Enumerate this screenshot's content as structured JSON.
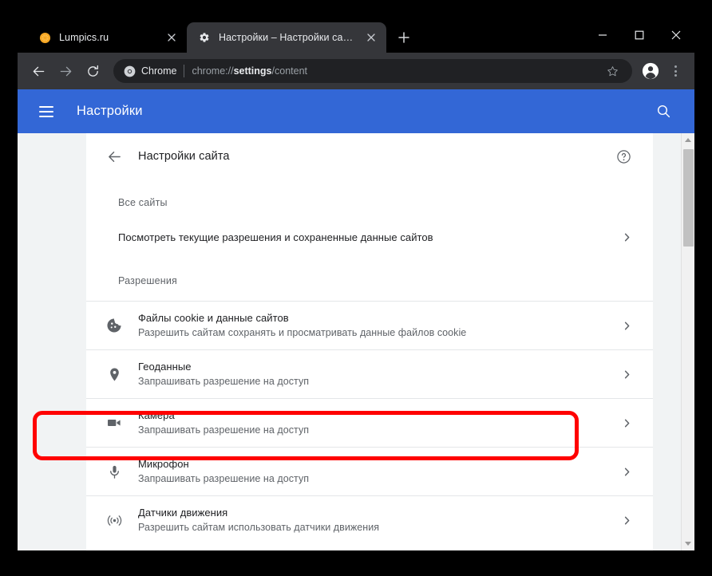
{
  "browser": {
    "tabs": [
      {
        "title": "Lumpics.ru",
        "favicon": "orange-citrus-icon",
        "active": false,
        "close_label": "×"
      },
      {
        "title": "Настройки – Настройки сайта",
        "favicon": "gear-icon",
        "active": true,
        "close_label": "×"
      }
    ],
    "new_tab_label": "+",
    "window_controls": {
      "minimize": "—",
      "maximize": "☐",
      "close": "×"
    },
    "toolbar": {
      "back_icon": "arrow-left-icon",
      "forward_icon": "arrow-right-icon",
      "reload_icon": "reload-icon",
      "omnibox": {
        "chip_label": "Chrome",
        "url_prefix": "chrome://",
        "url_bold": "settings",
        "url_suffix": "/content"
      },
      "star_icon": "star-icon",
      "profile_icon": "account-avatar-icon",
      "menu_icon": "three-dot-menu-icon"
    }
  },
  "settings": {
    "appbar": {
      "menu_icon": "hamburger-menu-icon",
      "title": "Настройки",
      "search_icon": "search-icon"
    },
    "page": {
      "back_icon": "arrow-left-icon",
      "title": "Настройки сайта",
      "help_icon": "help-circle-icon"
    },
    "all_sites": {
      "section_label": "Все сайты",
      "link_label": "Посмотреть текущие разрешения и сохраненные данные сайтов"
    },
    "permissions": {
      "section_label": "Разрешения",
      "items": [
        {
          "icon": "cookie-icon",
          "title": "Файлы cookie и данные сайтов",
          "subtitle": "Разрешить сайтам сохранять и просматривать данные файлов cookie",
          "highlighted": false
        },
        {
          "icon": "location-pin-icon",
          "title": "Геоданные",
          "subtitle": "Запрашивать разрешение на доступ",
          "highlighted": false
        },
        {
          "icon": "camera-icon",
          "title": "Камера",
          "subtitle": "Запрашивать разрешение на доступ",
          "highlighted": true
        },
        {
          "icon": "microphone-icon",
          "title": "Микрофон",
          "subtitle": "Запрашивать разрешение на доступ",
          "highlighted": false
        },
        {
          "icon": "motion-sensor-icon",
          "title": "Датчики движения",
          "subtitle": "Разрешить сайтам использовать датчики движения",
          "highlighted": false
        }
      ]
    },
    "scrollbar": {
      "up_icon": "scroll-up-arrow-icon",
      "down_icon": "scroll-down-arrow-icon"
    }
  },
  "annotation": {
    "highlight_color": "#ff0000",
    "target": "Камера"
  },
  "colors": {
    "accent_blue": "#3367d6",
    "tab_active": "#35363a",
    "toolbar": "#35363a",
    "window_bg": "#202124",
    "page_bg": "#f1f3f4",
    "text_primary": "#202124",
    "text_secondary": "#5f6368"
  }
}
